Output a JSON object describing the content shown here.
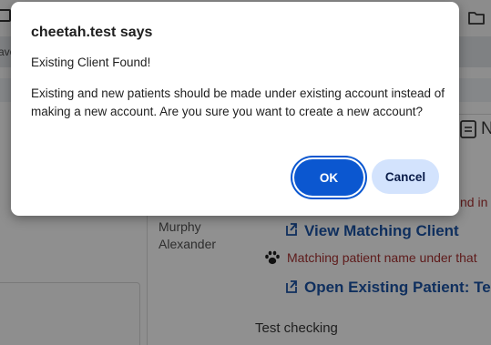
{
  "background": {
    "subbar_fragment": "ave",
    "client_names": [
      "Murphy",
      "Alexander"
    ],
    "view_matching_client": "View Matching Client",
    "matching_patient_warning": "Matching patient name under that",
    "open_existing_patient": "Open Existing Patient: Tes",
    "found_fragment": "nd in",
    "section_fragment": "N",
    "test_text": "Test checking"
  },
  "dialog": {
    "title": "cheetah.test says",
    "message_line1": "Existing Client Found!",
    "message_line2": "Existing and new patients should be made under existing account instead of making a new account. Are you sure you want to create a new account?",
    "ok_label": "OK",
    "cancel_label": "Cancel"
  },
  "colors": {
    "primary_button": "#0b57d0",
    "secondary_button": "#d3e3fd",
    "link": "#0f2f5e",
    "warning": "#5e1a1a"
  },
  "icons": [
    "folder-icon",
    "external-link-icon",
    "paw-icon",
    "document-icon"
  ]
}
